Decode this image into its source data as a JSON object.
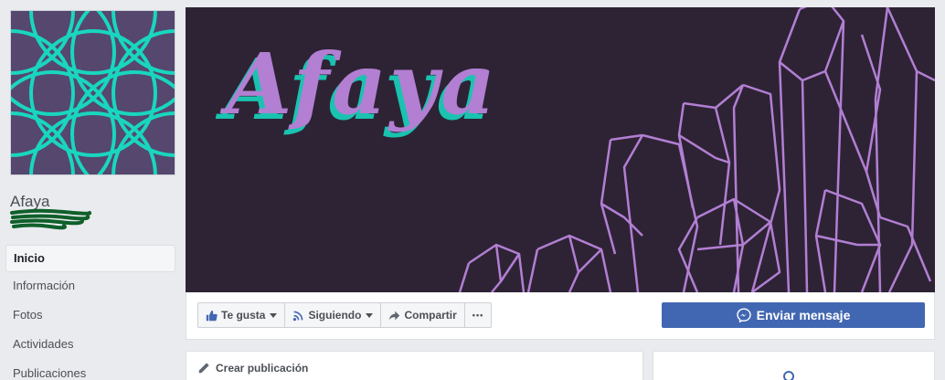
{
  "page": {
    "name": "Afaya"
  },
  "cover": {
    "title": "Afaya"
  },
  "sidebar": {
    "items": [
      {
        "label": "Inicio",
        "active": true
      },
      {
        "label": "Información"
      },
      {
        "label": "Fotos"
      },
      {
        "label": "Actividades"
      },
      {
        "label": "Publicaciones"
      }
    ]
  },
  "actions": {
    "like_label": "Te gusta",
    "following_label": "Siguiendo",
    "share_label": "Compartir",
    "more_label": "•••",
    "send_message_label": "Enviar mensaje"
  },
  "composer": {
    "create_post_label": "Crear publicación"
  },
  "colors": {
    "accent": "#4267b2",
    "cover_bg": "#2e2335",
    "cover_text": "#b27fd3",
    "cover_text_shadow": "#19c3b0",
    "profile_bg": "#55476e",
    "profile_pattern": "#19d6bf",
    "crystal_stroke": "#b27fd3"
  }
}
